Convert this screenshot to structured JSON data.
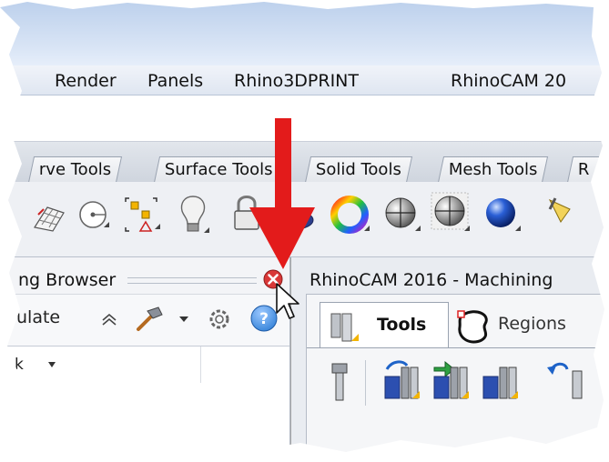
{
  "menubar": {
    "items": [
      "Render",
      "Panels",
      "Rhino3DPRINT",
      "RhinoCAM 20"
    ]
  },
  "toolbar_tabs": [
    "rve Tools",
    "Surface Tools",
    "Solid Tools",
    "Mesh Tools",
    "R"
  ],
  "toolbar_icons": [
    "grid-icon",
    "circle-point-icon",
    "polygon-points-icon",
    "lightbulb-icon",
    "lock-icon",
    "layer-icon",
    "color-wheel-icon",
    "sphere-wire-icon",
    "sphere-grid-icon",
    "sphere-render-icon",
    "spotlight-icon"
  ],
  "left_panel": {
    "title": "ng Browser",
    "toolbar_text": "ulate",
    "column_header": "k"
  },
  "right_panel": {
    "title": "RhinoCAM 2016 - Machining",
    "tab_tools": "Tools",
    "tab_regions": "Regions"
  },
  "colors": {
    "annotation_arrow": "#e31b1b",
    "close_button": "#d93838",
    "help_button": "#2f7fd6"
  }
}
